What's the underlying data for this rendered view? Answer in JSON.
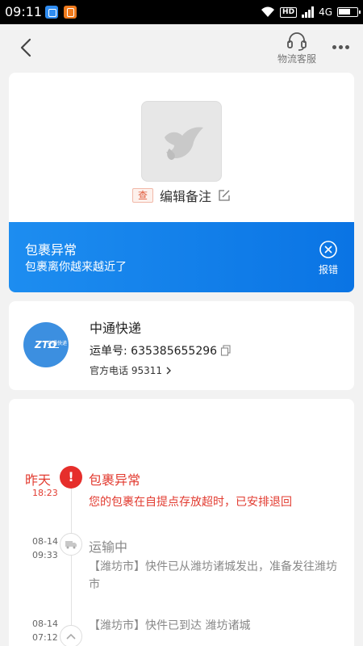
{
  "status_bar": {
    "time": "09:11",
    "hd_label": "HD",
    "network": "4G"
  },
  "header": {
    "service_label": "物流客服"
  },
  "package": {
    "badge": "查",
    "note_label": "编辑备注"
  },
  "alert": {
    "title": "包裹异常",
    "subtitle": "包裹离你越来越近了",
    "report_label": "报错"
  },
  "courier": {
    "logo_text": "ZTO",
    "logo_sub": "中通快递",
    "name": "中通快递",
    "waybill": "运单号: 635385655296",
    "phone": "官方电话 95311"
  },
  "timeline": {
    "events": [
      {
        "day": "昨天",
        "time": "18:23",
        "title": "包裹异常",
        "desc": "您的包裹在自提点存放超时，已安排退回"
      },
      {
        "date": "08-14",
        "time": "09:33",
        "title": "运输中",
        "desc": "【潍坊市】快件已从潍坊诸城发出，准备发往潍坊市"
      },
      {
        "date": "08-14",
        "time": "07:12",
        "desc": "【潍坊市】快件已到达 潍坊诸城"
      }
    ]
  },
  "colors": {
    "alert_blue": "#1d8df0",
    "error_red": "#e23b30",
    "background": "#f2f2f2"
  }
}
